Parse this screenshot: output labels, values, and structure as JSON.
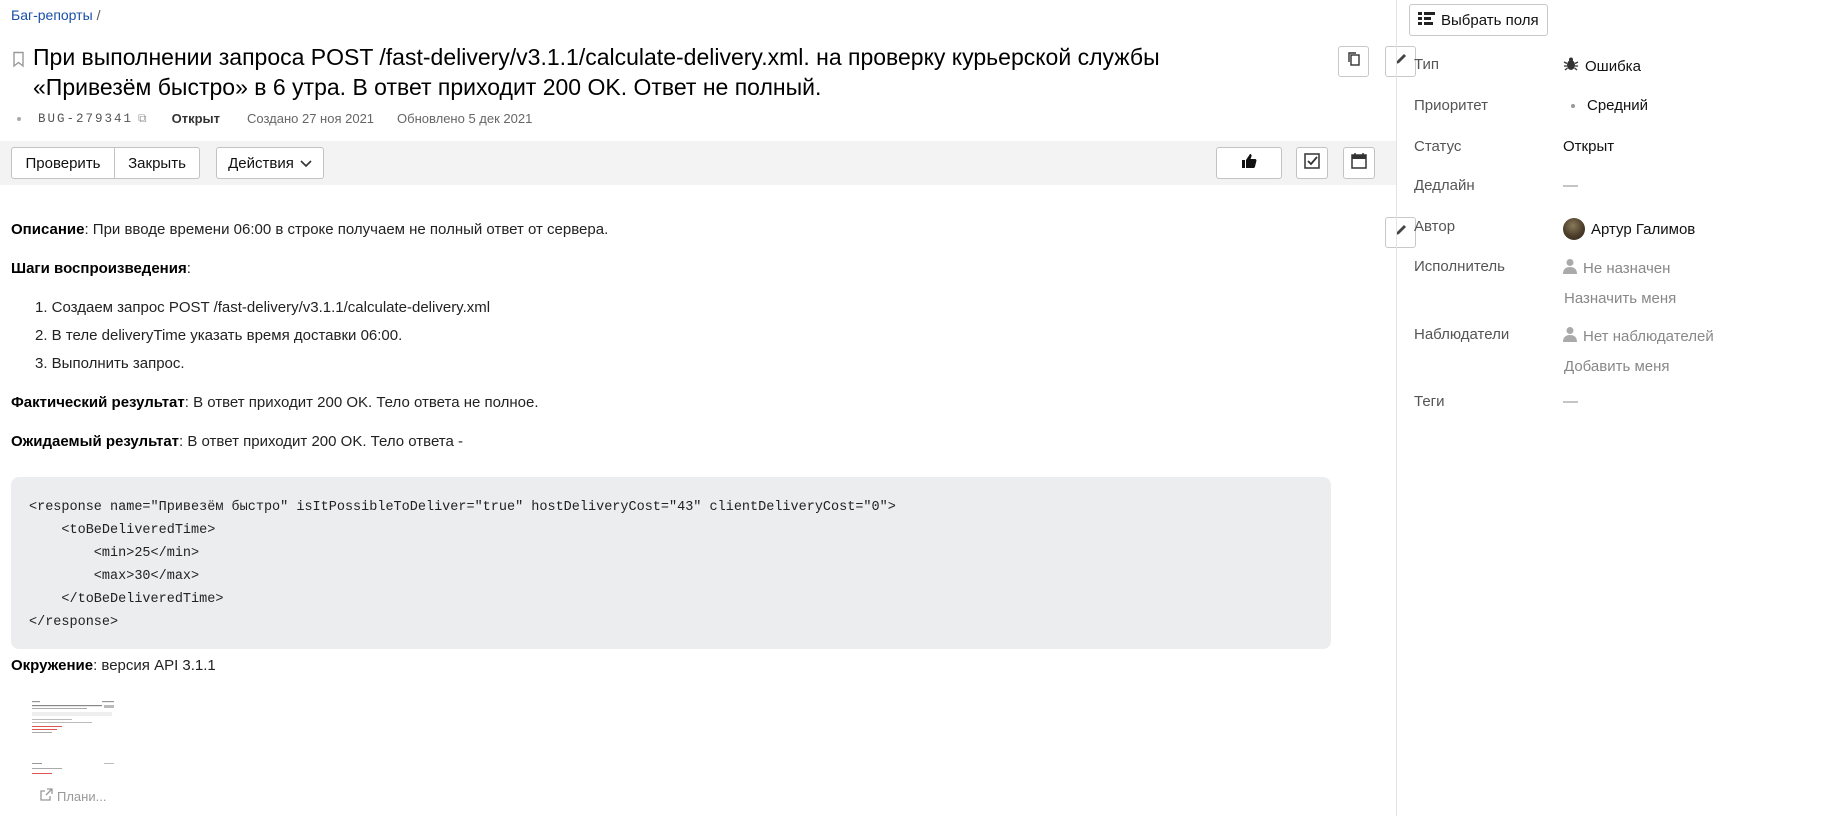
{
  "breadcrumb": {
    "link": "Баг-репорты",
    "sep": "/"
  },
  "issue": {
    "title": "При выполнении запроса POST /fast-delivery/v3.1.1/calculate-delivery.xml. на проверку курьерской службы «Привезём быстро» в 6 утра. В ответ приходит 200 OK. Ответ не полный.",
    "key": "BUG-279341",
    "status": "Открыт",
    "created": "Создано 27 ноя 2021",
    "updated": "Обновлено 5 дек 2021"
  },
  "toolbar": {
    "check": "Проверить",
    "close": "Закрыть",
    "actions": "Действия"
  },
  "description": {
    "desc_label": "Описание",
    "desc_text": ": При вводе времени 06:00 в строке получаем не полный ответ от сервера.",
    "steps_label": "Шаги воспроизведения",
    "steps_suffix": ":",
    "steps": [
      "1. Создаем запрос POST /fast-delivery/v3.1.1/calculate-delivery.xml",
      "2. В теле deliveryTime указать время доставки 06:00.",
      "3. Выполнить запрос."
    ],
    "actual_label": "Фактический результат",
    "actual_text": ": В ответ приходит 200 OK. Тело ответа не полное.",
    "expected_label": "Ожидаемый результат",
    "expected_text": ": В ответ приходит 200 OK. Тело ответа -",
    "code": "<response name=\"Привезём быстро\" isItPossibleToDeliver=\"true\" hostDeliveryCost=\"43\" clientDeliveryCost=\"0\">\n    <toBeDeliveredTime>\n        <min>25</min>\n        <max>30</max>\n    </toBeDeliveredTime>\n</response>",
    "env_label": "Окружение",
    "env_text": ": версия API 3.1.1",
    "attachment_label": "Плани..."
  },
  "sidebar": {
    "select_fields": "Выбрать поля",
    "props": {
      "type_label": "Тип",
      "type_value": "Ошибка",
      "priority_label": "Приоритет",
      "priority_value": "Средний",
      "status_label": "Статус",
      "status_value": "Открыт",
      "deadline_label": "Дедлайн",
      "deadline_value": "—",
      "author_label": "Автор",
      "author_value": "Артур Галимов",
      "assignee_label": "Исполнитель",
      "assignee_value": "Не назначен",
      "assign_me": "Назначить меня",
      "watchers_label": "Наблюдатели",
      "watchers_value": "Нет наблюдателей",
      "add_me": "Добавить меня",
      "tags_label": "Теги",
      "tags_value": "—"
    }
  },
  "colors": {
    "link": "#1a4fa8",
    "toolbar_bg": "#f3f3f3",
    "code_bg": "#ebedef"
  },
  "icons": [
    "bookmark-icon",
    "copy-icon",
    "edit-icon",
    "thumbs-up-icon",
    "checklist-icon",
    "calendar-icon",
    "chevron-down-icon",
    "fields-icon",
    "bug-icon",
    "user-icon",
    "external-link-icon"
  ]
}
